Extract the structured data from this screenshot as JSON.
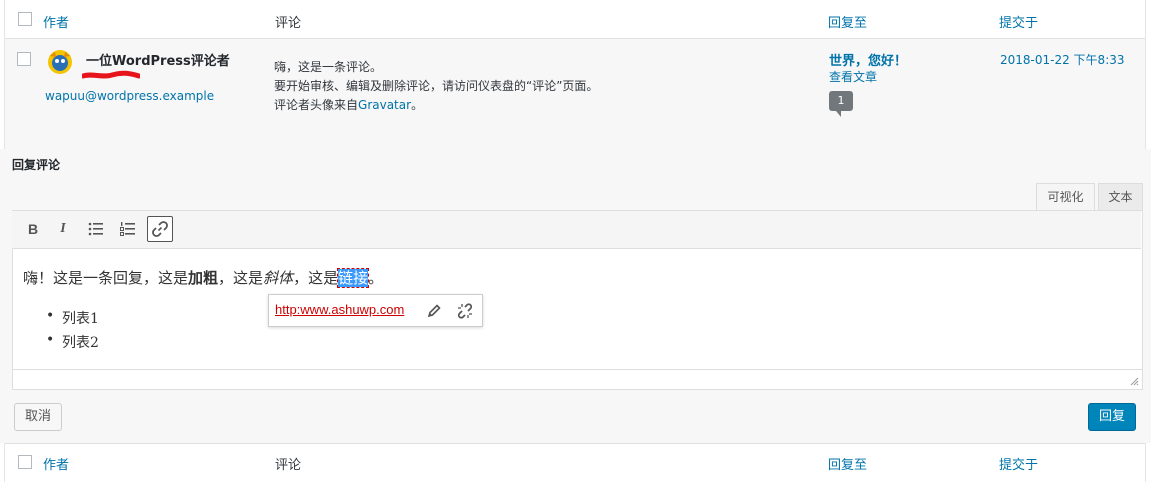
{
  "header": {
    "col_author": "作者",
    "col_comment": "评论",
    "col_in_response_to": "回复至",
    "col_submitted_on": "提交于"
  },
  "comment": {
    "author_name": "一位WordPress评论者",
    "author_email": "wapuu@wordpress.example",
    "text_line1": "嗨，这是一条评论。",
    "text_line2": "要开始审核、编辑及删除评论，请访问仪表盘的“评论”页面。",
    "text_line3_prefix": "评论者头像来自",
    "text_line3_link": "Gravatar",
    "text_line3_suffix": "。",
    "post_title": "世界，您好！",
    "view_post": "查看文章",
    "comment_count": "1",
    "submitted": "2018-01-22 下午8:33"
  },
  "reply": {
    "title": "回复评论",
    "tab_visual": "可视化",
    "tab_text": "文本",
    "toolbar": {
      "bold": "B",
      "italic": "I"
    },
    "content_prefix": "嗨！这是一条回复，这是",
    "content_bold": "加粗",
    "content_mid": "，这是",
    "content_italic": "斜体",
    "content_mid2": "，这是",
    "content_link": "链接",
    "content_end": "。",
    "list": [
      "列表1",
      "列表2"
    ],
    "link_url": "http:www.ashuwp.com",
    "cancel_label": "取消",
    "submit_label": "回复"
  },
  "colors": {
    "link": "#0073aa",
    "primary": "#0085ba"
  },
  "icons": [
    "wapuu-avatar",
    "bullet-list-icon",
    "numbered-list-icon",
    "link-icon",
    "pencil-icon",
    "unlink-icon",
    "resize-handle-icon"
  ]
}
